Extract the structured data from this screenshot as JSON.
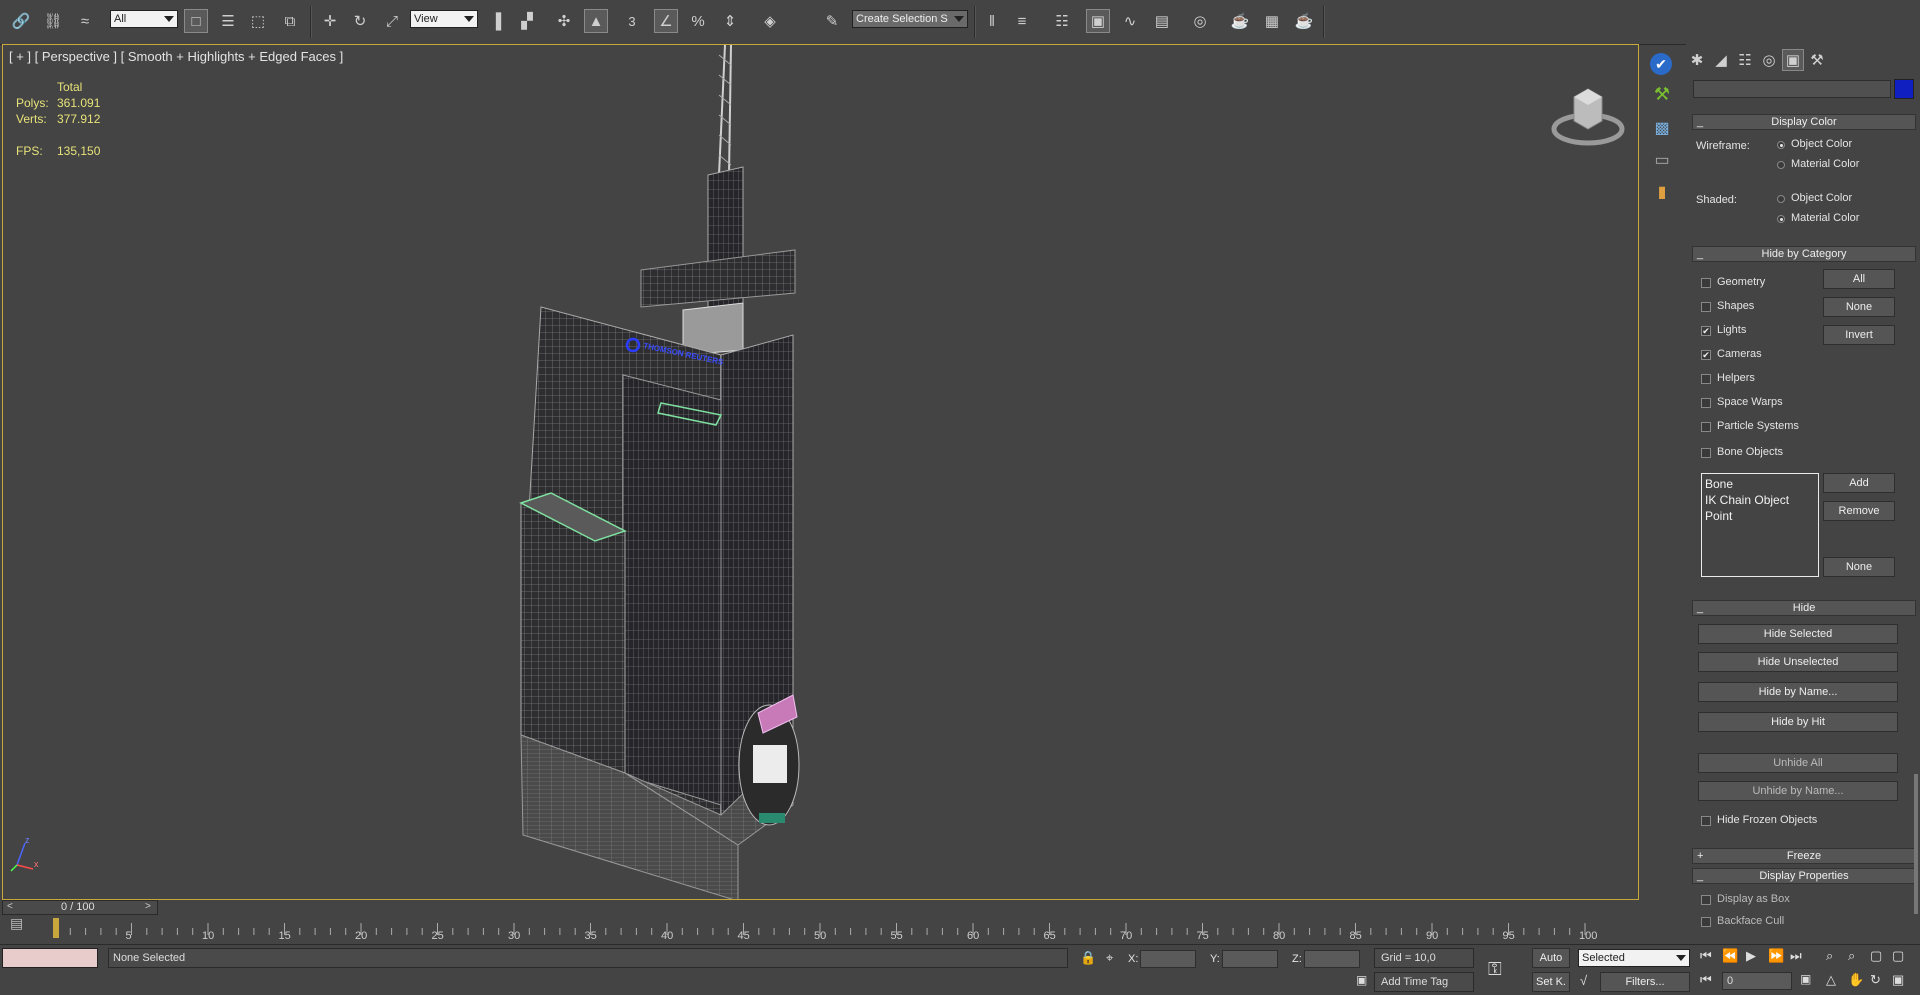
{
  "toolbar": {
    "selection_filter": "All",
    "ref_coord": "View",
    "snap_angle": "3",
    "named_selection": "Create Selection S"
  },
  "viewport": {
    "label": "[ + ] [ Perspective ] [ Smooth + Highlights + Edged Faces ]",
    "stats_header": "Total",
    "polys_label": "Polys:",
    "polys_value": "361.091",
    "verts_label": "Verts:",
    "verts_value": "377.912",
    "fps_label": "FPS:",
    "fps_value": "135,150",
    "building_sign": "THOMSON REUTERS",
    "axis_z": "z",
    "axis_x": "x"
  },
  "command_panel": {
    "name_field": "",
    "object_color": "#1020c0",
    "display_color": {
      "title": "Display Color",
      "wireframe_label": "Wireframe:",
      "shaded_label": "Shaded:",
      "object_color": "Object Color",
      "material_color": "Material Color",
      "wireframe_selected": "Object Color",
      "shaded_selected": "Material Color"
    },
    "hide_by_category": {
      "title": "Hide by Category",
      "items": [
        {
          "label": "Geometry",
          "checked": false
        },
        {
          "label": "Shapes",
          "checked": false
        },
        {
          "label": "Lights",
          "checked": true
        },
        {
          "label": "Cameras",
          "checked": true
        },
        {
          "label": "Helpers",
          "checked": false
        },
        {
          "label": "Space Warps",
          "checked": false
        },
        {
          "label": "Particle Systems",
          "checked": false
        },
        {
          "label": "Bone Objects",
          "checked": false
        }
      ],
      "all_button": "All",
      "none_button": "None",
      "invert_button": "Invert",
      "list_items": [
        "Bone",
        "IK Chain Object",
        "Point"
      ],
      "add_button": "Add",
      "remove_button": "Remove",
      "list_none_button": "None"
    },
    "hide": {
      "title": "Hide",
      "hide_selected": "Hide Selected",
      "hide_unselected": "Hide Unselected",
      "hide_by_name": "Hide by Name...",
      "hide_by_hit": "Hide by Hit",
      "unhide_all": "Unhide All",
      "unhide_by_name": "Unhide by Name...",
      "hide_frozen": "Hide Frozen Objects"
    },
    "freeze": {
      "title": "Freeze"
    },
    "display_properties": {
      "title": "Display Properties",
      "display_as_box": "Display as Box",
      "backface_cull": "Backface Cull"
    }
  },
  "timeline": {
    "frame_counter": "0 / 100",
    "ticks": [
      "5",
      "10",
      "15",
      "20",
      "25",
      "30",
      "35",
      "40",
      "45",
      "50",
      "55",
      "60",
      "65",
      "70",
      "75",
      "80",
      "85",
      "90",
      "95",
      "100"
    ]
  },
  "statusbar": {
    "selection_status": "None Selected",
    "x_label": "X:",
    "y_label": "Y:",
    "z_label": "Z:",
    "grid": "Grid = 10,0",
    "add_time_tag": "Add Time Tag",
    "auto_key": "Auto",
    "set_key": "Set K.",
    "key_filter": "Selected",
    "filters": "Filters...",
    "current_frame": "0"
  }
}
